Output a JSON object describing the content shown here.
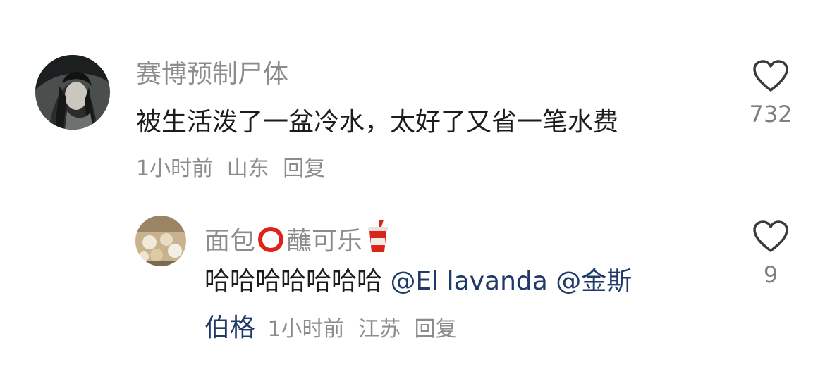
{
  "comments": [
    {
      "username": "赛博预制尸体",
      "text": "被生活泼了一盆冷水，太好了又省一笔水费",
      "time": "1小时前",
      "location": "山东",
      "reply_label": "回复",
      "likes": "732"
    }
  ],
  "replies": [
    {
      "username_part1": "面包",
      "username_part2": "蘸可乐",
      "username_icons": [
        "red-circle-icon",
        "cup-with-straw-icon"
      ],
      "text_line1": "哈哈哈哈哈哈哈",
      "mention1": "@El lavanda",
      "mention2": "@金斯",
      "text_line2": "伯格",
      "time": "1小时前",
      "location": "江苏",
      "reply_label": "回复",
      "likes": "9"
    }
  ],
  "colors": {
    "username": "#8c8c8c",
    "text": "#1c1c1c",
    "meta": "#8c8c8c",
    "mention": "#1f3a68",
    "like_icon": "#3a3a3a"
  }
}
